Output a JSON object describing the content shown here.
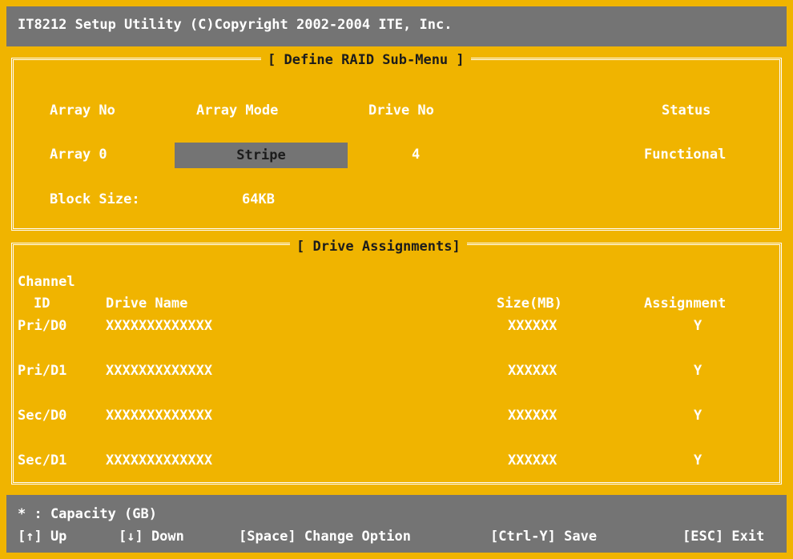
{
  "title": "IT8212 Setup Utility (C)Copyright 2002-2004 ITE, Inc.",
  "raid_menu": {
    "title": "[ Define RAID Sub-Menu ]",
    "headers": {
      "array_no": "Array No",
      "array_mode": "Array Mode",
      "drive_no": "Drive No",
      "status": "Status"
    },
    "array": {
      "label": "Array 0",
      "mode": "Stripe",
      "drive_no": "4",
      "status": "Functional"
    },
    "block_size_label": "Block Size:",
    "block_size_value": "64KB"
  },
  "drive_assignments": {
    "title": "[ Drive Assignments]",
    "headers": {
      "channel": "Channel",
      "id": "ID",
      "drive_name": "Drive Name",
      "size": "Size(MB)",
      "assignment": "Assignment"
    },
    "rows": [
      {
        "channel": "Pri/D0",
        "name": "XXXXXXXXXXXXX",
        "size": "XXXXXX",
        "assignment": "Y"
      },
      {
        "channel": "Pri/D1",
        "name": "XXXXXXXXXXXXX",
        "size": "XXXXXX",
        "assignment": "Y"
      },
      {
        "channel": "Sec/D0",
        "name": "XXXXXXXXXXXXX",
        "size": "XXXXXX",
        "assignment": "Y"
      },
      {
        "channel": "Sec/D1",
        "name": "XXXXXXXXXXXXX",
        "size": "XXXXXX",
        "assignment": "Y"
      }
    ]
  },
  "footer": {
    "capacity_note": "* : Capacity (GB)",
    "keys": {
      "up": "[↑] Up",
      "down": "[↓] Down",
      "change": "[Space] Change Option",
      "save": "[Ctrl-Y] Save",
      "exit": "[ESC] Exit"
    }
  },
  "colors": {
    "background": "#f0b400",
    "bar": "#747474",
    "text": "#ffffff",
    "dark_text": "#1c1c1c"
  }
}
